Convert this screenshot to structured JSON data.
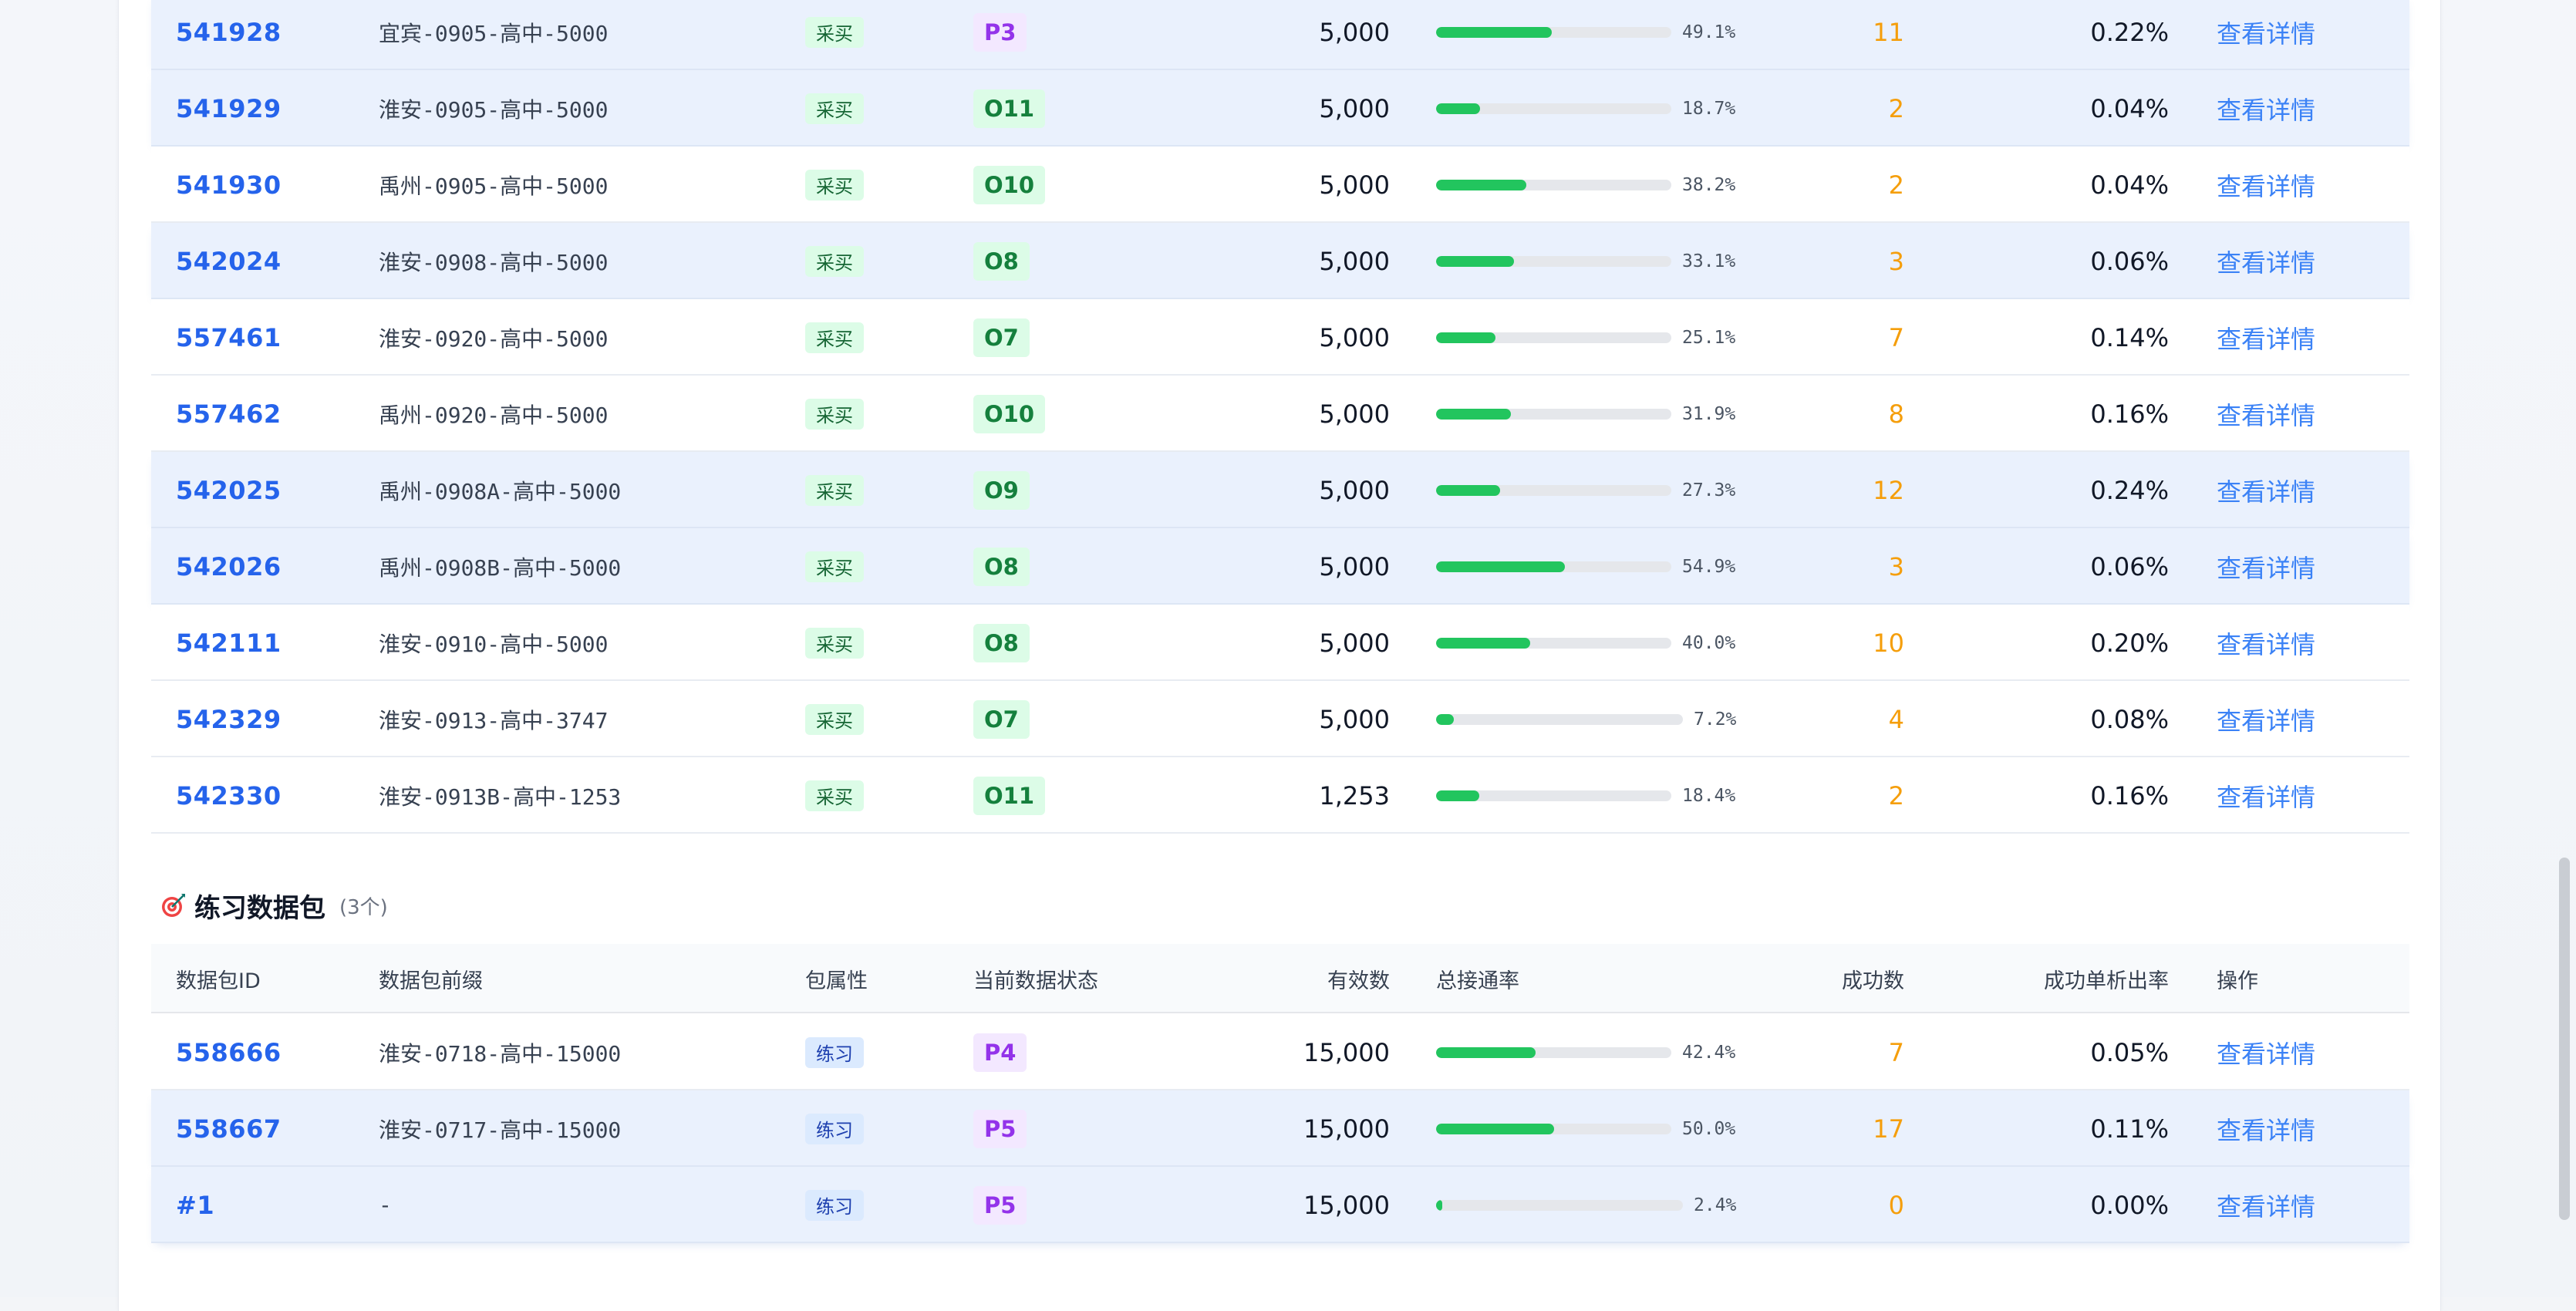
{
  "section_count": "(3个)",
  "section_title": "练习数据包",
  "headers": {
    "id": "数据包ID",
    "prefix": "数据包前缀",
    "attr": "包属性",
    "state": "当前数据状态",
    "valid": "有效数",
    "rate": "总接通率",
    "succ": "成功数",
    "ratio": "成功单析出率",
    "op": "操作"
  },
  "purchase_rows": [
    {
      "id": "541928",
      "prefix": "宜宾-0905-高中-5000",
      "attr": "采买",
      "state": "P3",
      "state_kind": "P",
      "valid": "5,000",
      "rate": 0.491,
      "rate_text": "49.1%",
      "succ": "11",
      "ratio": "0.22%",
      "op": "查看详情",
      "highlight": true
    },
    {
      "id": "541929",
      "prefix": "淮安-0905-高中-5000",
      "attr": "采买",
      "state": "O11",
      "state_kind": "O",
      "valid": "5,000",
      "rate": 0.187,
      "rate_text": "18.7%",
      "succ": "2",
      "ratio": "0.04%",
      "op": "查看详情",
      "highlight": true
    },
    {
      "id": "541930",
      "prefix": "禹州-0905-高中-5000",
      "attr": "采买",
      "state": "O10",
      "state_kind": "O",
      "valid": "5,000",
      "rate": 0.382,
      "rate_text": "38.2%",
      "succ": "2",
      "ratio": "0.04%",
      "op": "查看详情",
      "highlight": false
    },
    {
      "id": "542024",
      "prefix": "淮安-0908-高中-5000",
      "attr": "采买",
      "state": "O8",
      "state_kind": "O",
      "valid": "5,000",
      "rate": 0.331,
      "rate_text": "33.1%",
      "succ": "3",
      "ratio": "0.06%",
      "op": "查看详情",
      "highlight": true
    },
    {
      "id": "557461",
      "prefix": "淮安-0920-高中-5000",
      "attr": "采买",
      "state": "O7",
      "state_kind": "O",
      "valid": "5,000",
      "rate": 0.251,
      "rate_text": "25.1%",
      "succ": "7",
      "ratio": "0.14%",
      "op": "查看详情",
      "highlight": false
    },
    {
      "id": "557462",
      "prefix": "禹州-0920-高中-5000",
      "attr": "采买",
      "state": "O10",
      "state_kind": "O",
      "valid": "5,000",
      "rate": 0.319,
      "rate_text": "31.9%",
      "succ": "8",
      "ratio": "0.16%",
      "op": "查看详情",
      "highlight": false
    },
    {
      "id": "542025",
      "prefix": "禹州-0908A-高中-5000",
      "attr": "采买",
      "state": "O9",
      "state_kind": "O",
      "valid": "5,000",
      "rate": 0.273,
      "rate_text": "27.3%",
      "succ": "12",
      "ratio": "0.24%",
      "op": "查看详情",
      "highlight": true
    },
    {
      "id": "542026",
      "prefix": "禹州-0908B-高中-5000",
      "attr": "采买",
      "state": "O8",
      "state_kind": "O",
      "valid": "5,000",
      "rate": 0.549,
      "rate_text": "54.9%",
      "succ": "3",
      "ratio": "0.06%",
      "op": "查看详情",
      "highlight": true
    },
    {
      "id": "542111",
      "prefix": "淮安-0910-高中-5000",
      "attr": "采买",
      "state": "O8",
      "state_kind": "O",
      "valid": "5,000",
      "rate": 0.4,
      "rate_text": "40.0%",
      "succ": "10",
      "ratio": "0.20%",
      "op": "查看详情",
      "highlight": false
    },
    {
      "id": "542329",
      "prefix": "淮安-0913-高中-3747",
      "attr": "采买",
      "state": "O7",
      "state_kind": "O",
      "valid": "5,000",
      "rate": 0.072,
      "rate_text": "7.2%",
      "succ": "4",
      "ratio": "0.08%",
      "op": "查看详情",
      "highlight": false
    },
    {
      "id": "542330",
      "prefix": "淮安-0913B-高中-1253",
      "attr": "采买",
      "state": "O11",
      "state_kind": "O",
      "valid": "1,253",
      "rate": 0.184,
      "rate_text": "18.4%",
      "succ": "2",
      "ratio": "0.16%",
      "op": "查看详情",
      "highlight": false
    }
  ],
  "practice_rows": [
    {
      "id": "558666",
      "prefix": "淮安-0718-高中-15000",
      "attr": "练习",
      "state": "P4",
      "state_kind": "P",
      "valid": "15,000",
      "rate": 0.424,
      "rate_text": "42.4%",
      "succ": "7",
      "ratio": "0.05%",
      "op": "查看详情",
      "highlight": false
    },
    {
      "id": "558667",
      "prefix": "淮安-0717-高中-15000",
      "attr": "练习",
      "state": "P5",
      "state_kind": "P",
      "valid": "15,000",
      "rate": 0.5,
      "rate_text": "50.0%",
      "succ": "17",
      "ratio": "0.11%",
      "op": "查看详情",
      "highlight": true
    },
    {
      "id": "#1",
      "prefix": "-",
      "attr": "练习",
      "state": "P5",
      "state_kind": "P",
      "valid": "15,000",
      "rate": 0.024,
      "rate_text": "2.4%",
      "succ": "0",
      "ratio": "0.00%",
      "op": "查看详情",
      "highlight": true
    }
  ]
}
